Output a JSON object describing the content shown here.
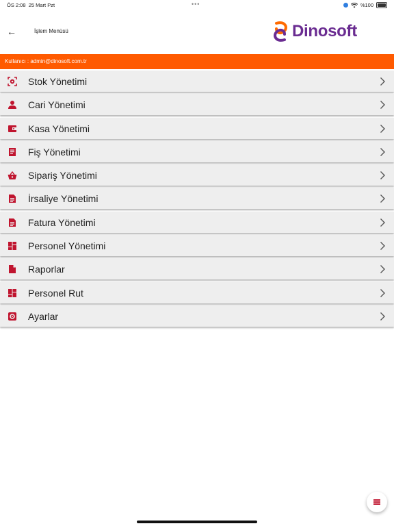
{
  "status": {
    "time": "ÖS 2:08",
    "date": "25 Mart Pzt",
    "battery": "%100"
  },
  "header": {
    "title": "İşlem Menüsü",
    "brand": "Dinosoft"
  },
  "user_bar": {
    "text": "Kullanıcı : admin@dinosoft.com.tr"
  },
  "colors": {
    "accent": "#ff5a00",
    "icon": "#c0152f",
    "brand": "#6a2c91",
    "row_bg": "#eeeeee"
  },
  "menu": {
    "items": [
      {
        "label": "Stok Yönetimi",
        "icon": "barcode-scan-icon"
      },
      {
        "label": "Cari Yönetimi",
        "icon": "person-icon"
      },
      {
        "label": "Kasa Yönetimi",
        "icon": "wallet-icon"
      },
      {
        "label": "Fiş Yönetimi",
        "icon": "receipt-icon"
      },
      {
        "label": "Sipariş Yönetimi",
        "icon": "basket-icon"
      },
      {
        "label": "İrsaliye Yönetimi",
        "icon": "document-icon"
      },
      {
        "label": "Fatura Yönetimi",
        "icon": "document-icon"
      },
      {
        "label": "Personel Yönetimi",
        "icon": "dashboard-icon"
      },
      {
        "label": "Raporlar",
        "icon": "file-icon"
      },
      {
        "label": "Personel Rut",
        "icon": "dashboard-icon"
      },
      {
        "label": "Ayarlar",
        "icon": "settings-icon"
      }
    ]
  }
}
